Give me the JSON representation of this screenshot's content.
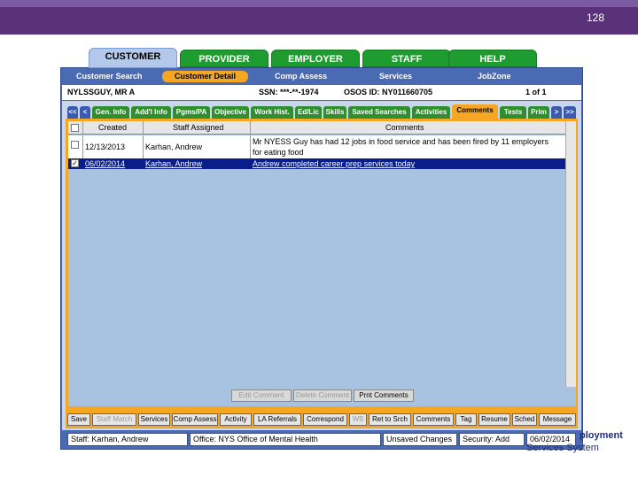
{
  "slide": {
    "number": "128"
  },
  "nav_tabs": [
    "CUSTOMER",
    "PROVIDER",
    "EMPLOYER",
    "STAFF",
    "HELP"
  ],
  "sub_nav": [
    "Customer Search",
    "Customer Detail",
    "Comp Assess",
    "Services",
    "JobZone"
  ],
  "info": {
    "name": "NYLSSGUY, MR  A",
    "ssn": "SSN: ***-**-1974",
    "osos_id": "OSOS ID: NY011660705",
    "record": "1 of 1"
  },
  "sub_tabs": {
    "prev": "<<",
    "prev1": "<",
    "items": [
      "Gen. Info",
      "Add'l Info",
      "Pgms/PA",
      "Objective",
      "Work Hist.",
      "Ed/Lic",
      "Skills",
      "Saved Searches",
      "Activities",
      "Comments",
      "Tests",
      "Prim"
    ],
    "next1": ">",
    "next": ">>"
  },
  "table": {
    "headers": {
      "created": "Created",
      "staff": "Staff Assigned",
      "comments": "Comments"
    },
    "rows": [
      {
        "checked": "",
        "created": "12/13/2013",
        "staff": "Karhan, Andrew",
        "comment_line1": "Mr NYESS Guy has had 12 jobs in food service and has been fired by 11 employers",
        "comment_line2": "for eating food"
      },
      {
        "checked": "✓",
        "created": "06/02/2014",
        "staff": "Karhan, Andrew",
        "comment_line1": "Andrew completed career prep services today"
      }
    ]
  },
  "actions": {
    "edit": "Edit Comment",
    "delete": "Delete Comment",
    "print": "Prnt Comments"
  },
  "bottom_buttons": [
    "Save",
    "Staff Match",
    "Services",
    "Comp Assess",
    "Activity",
    "LA Referrals",
    "Correspond",
    "WB",
    "Ret to Srch",
    "Comments",
    "Tag",
    "Resume",
    "Sched",
    "Message"
  ],
  "status": {
    "staff": "Staff: Karhan, Andrew",
    "office": "Office: NYS Office of Mental Health",
    "unsaved": "Unsaved Changes",
    "security": "Security: Add",
    "date": "06/02/2014"
  },
  "logo": {
    "line1": "ployment",
    "line2": "Services System"
  }
}
